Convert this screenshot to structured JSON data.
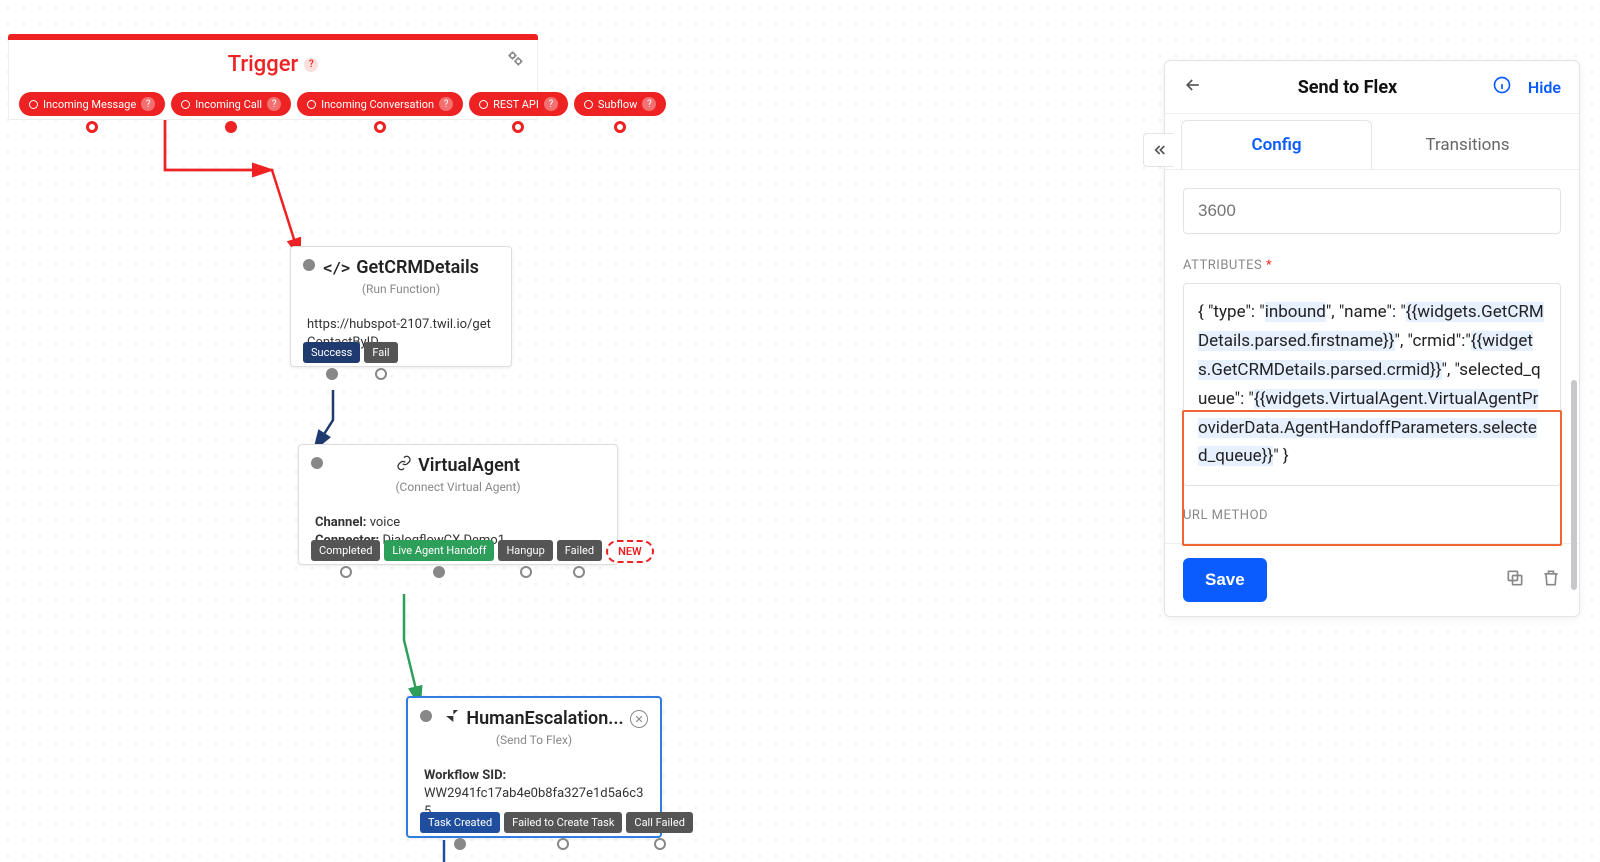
{
  "trigger": {
    "title": "Trigger",
    "outputs": [
      "Incoming Message",
      "Incoming Call",
      "Incoming Conversation",
      "REST API",
      "Subflow"
    ]
  },
  "nodes": {
    "crm": {
      "title": "GetCRMDetails",
      "subtitle": "(Run Function)",
      "body": "https://hubspot-2107.twil.io/getContactByID",
      "outputs": {
        "success": "Success",
        "fail": "Fail"
      }
    },
    "va": {
      "title": "VirtualAgent",
      "subtitle": "(Connect Virtual Agent)",
      "channel_label": "Channel:",
      "channel_value": "voice",
      "connector_label": "Connector:",
      "connector_value": "DialogflowCX Demo1",
      "outputs": {
        "completed": "Completed",
        "handoff": "Live Agent Handoff",
        "hangup": "Hangup",
        "failed": "Failed",
        "new": "NEW"
      }
    },
    "he": {
      "title": "HumanEscalation...",
      "subtitle": "(Send To Flex)",
      "sid_label": "Workflow SID:",
      "sid_value": "WW2941fc17ab4e0b8fa327e1d5a6c35...",
      "outputs": {
        "created": "Task Created",
        "failed": "Failed to Create Task",
        "callfailed": "Call Failed"
      }
    }
  },
  "panel": {
    "title": "Send to Flex",
    "hide": "Hide",
    "tabs": {
      "config": "Config",
      "transitions": "Transitions"
    },
    "timeout_placeholder": "3600",
    "attr_label": "ATTRIBUTES",
    "attr_text_parts": {
      "p1": "{ \"type\": \"",
      "p2": "inbound",
      "p3": "\", \"name\": \"",
      "p4": "{{widgets.GetCRMDetails.parsed.firstname}}",
      "p5": "\", \"crmid\":\"",
      "p6": "{{widgets.GetCRMDetails.parsed.crmid}}",
      "p7": "\", \"selected_queue\": \"",
      "p8": "{{widgets.VirtualAgent.VirtualAgentProviderData.AgentHandoffParameters.selected_queue}}",
      "p9": "\" }"
    },
    "url_method_label": "URL METHOD",
    "save": "Save"
  }
}
